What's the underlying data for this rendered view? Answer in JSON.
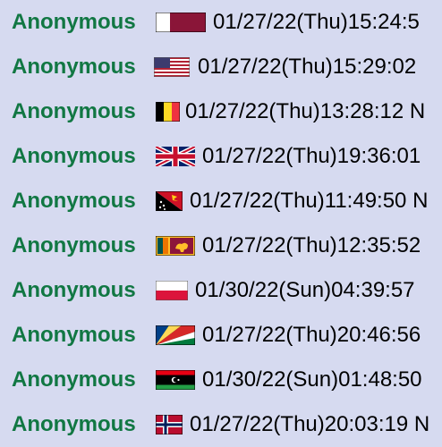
{
  "posts": [
    {
      "name": "Anonymous",
      "flag": "qatar-flag-icon",
      "datetime": "01/27/22(Thu)15:24:5"
    },
    {
      "name": "Anonymous",
      "flag": "united-states-flag-icon",
      "datetime": "01/27/22(Thu)15:29:02"
    },
    {
      "name": "Anonymous",
      "flag": "belgium-flag-icon",
      "datetime": "01/27/22(Thu)13:28:12 N"
    },
    {
      "name": "Anonymous",
      "flag": "united-kingdom-flag-icon",
      "datetime": "01/27/22(Thu)19:36:01"
    },
    {
      "name": "Anonymous",
      "flag": "papua-new-guinea-flag-icon",
      "datetime": "01/27/22(Thu)11:49:50 N"
    },
    {
      "name": "Anonymous",
      "flag": "sri-lanka-flag-icon",
      "datetime": "01/27/22(Thu)12:35:52"
    },
    {
      "name": "Anonymous",
      "flag": "poland-flag-icon",
      "datetime": "01/30/22(Sun)04:39:57"
    },
    {
      "name": "Anonymous",
      "flag": "seychelles-flag-icon",
      "datetime": "01/27/22(Thu)20:46:56"
    },
    {
      "name": "Anonymous",
      "flag": "libya-flag-icon",
      "datetime": "01/30/22(Sun)01:48:50"
    },
    {
      "name": "Anonymous",
      "flag": "norway-flag-icon",
      "datetime": "01/27/22(Thu)20:03:19 N"
    }
  ],
  "colors": {
    "background": "#d6daf0",
    "name": "#117743",
    "text": "#000000"
  }
}
